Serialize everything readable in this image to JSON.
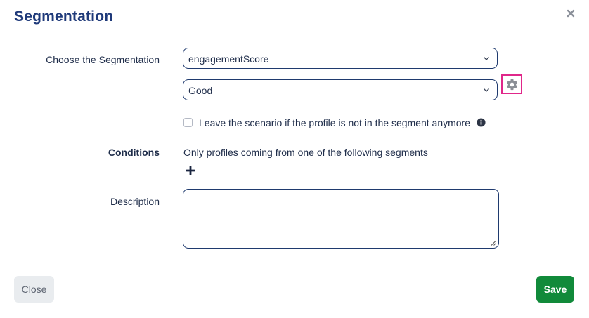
{
  "dialog": {
    "title": "Segmentation"
  },
  "form": {
    "segmentation_label": "Choose the Segmentation",
    "segmentation_value": "engagementScore",
    "segment_value": "Good",
    "leave_checkbox_label": "Leave the scenario if the profile is not in the segment anymore",
    "leave_checkbox_checked": false,
    "conditions_label": "Conditions",
    "conditions_text": "Only profiles coming from one of the following segments",
    "description_label": "Description",
    "description_value": ""
  },
  "footer": {
    "close_label": "Close",
    "save_label": "Save"
  },
  "icons": {
    "close": "close-icon",
    "chevron": "chevron-down-icon",
    "settings": "gear-icon",
    "info": "info-icon",
    "add": "plus-icon"
  },
  "colors": {
    "title": "#1f3a7a",
    "primary_action": "#118a3a",
    "highlight": "#e0278a",
    "field_border": "#1f3a6e",
    "secondary_button": "#e9ecef"
  }
}
